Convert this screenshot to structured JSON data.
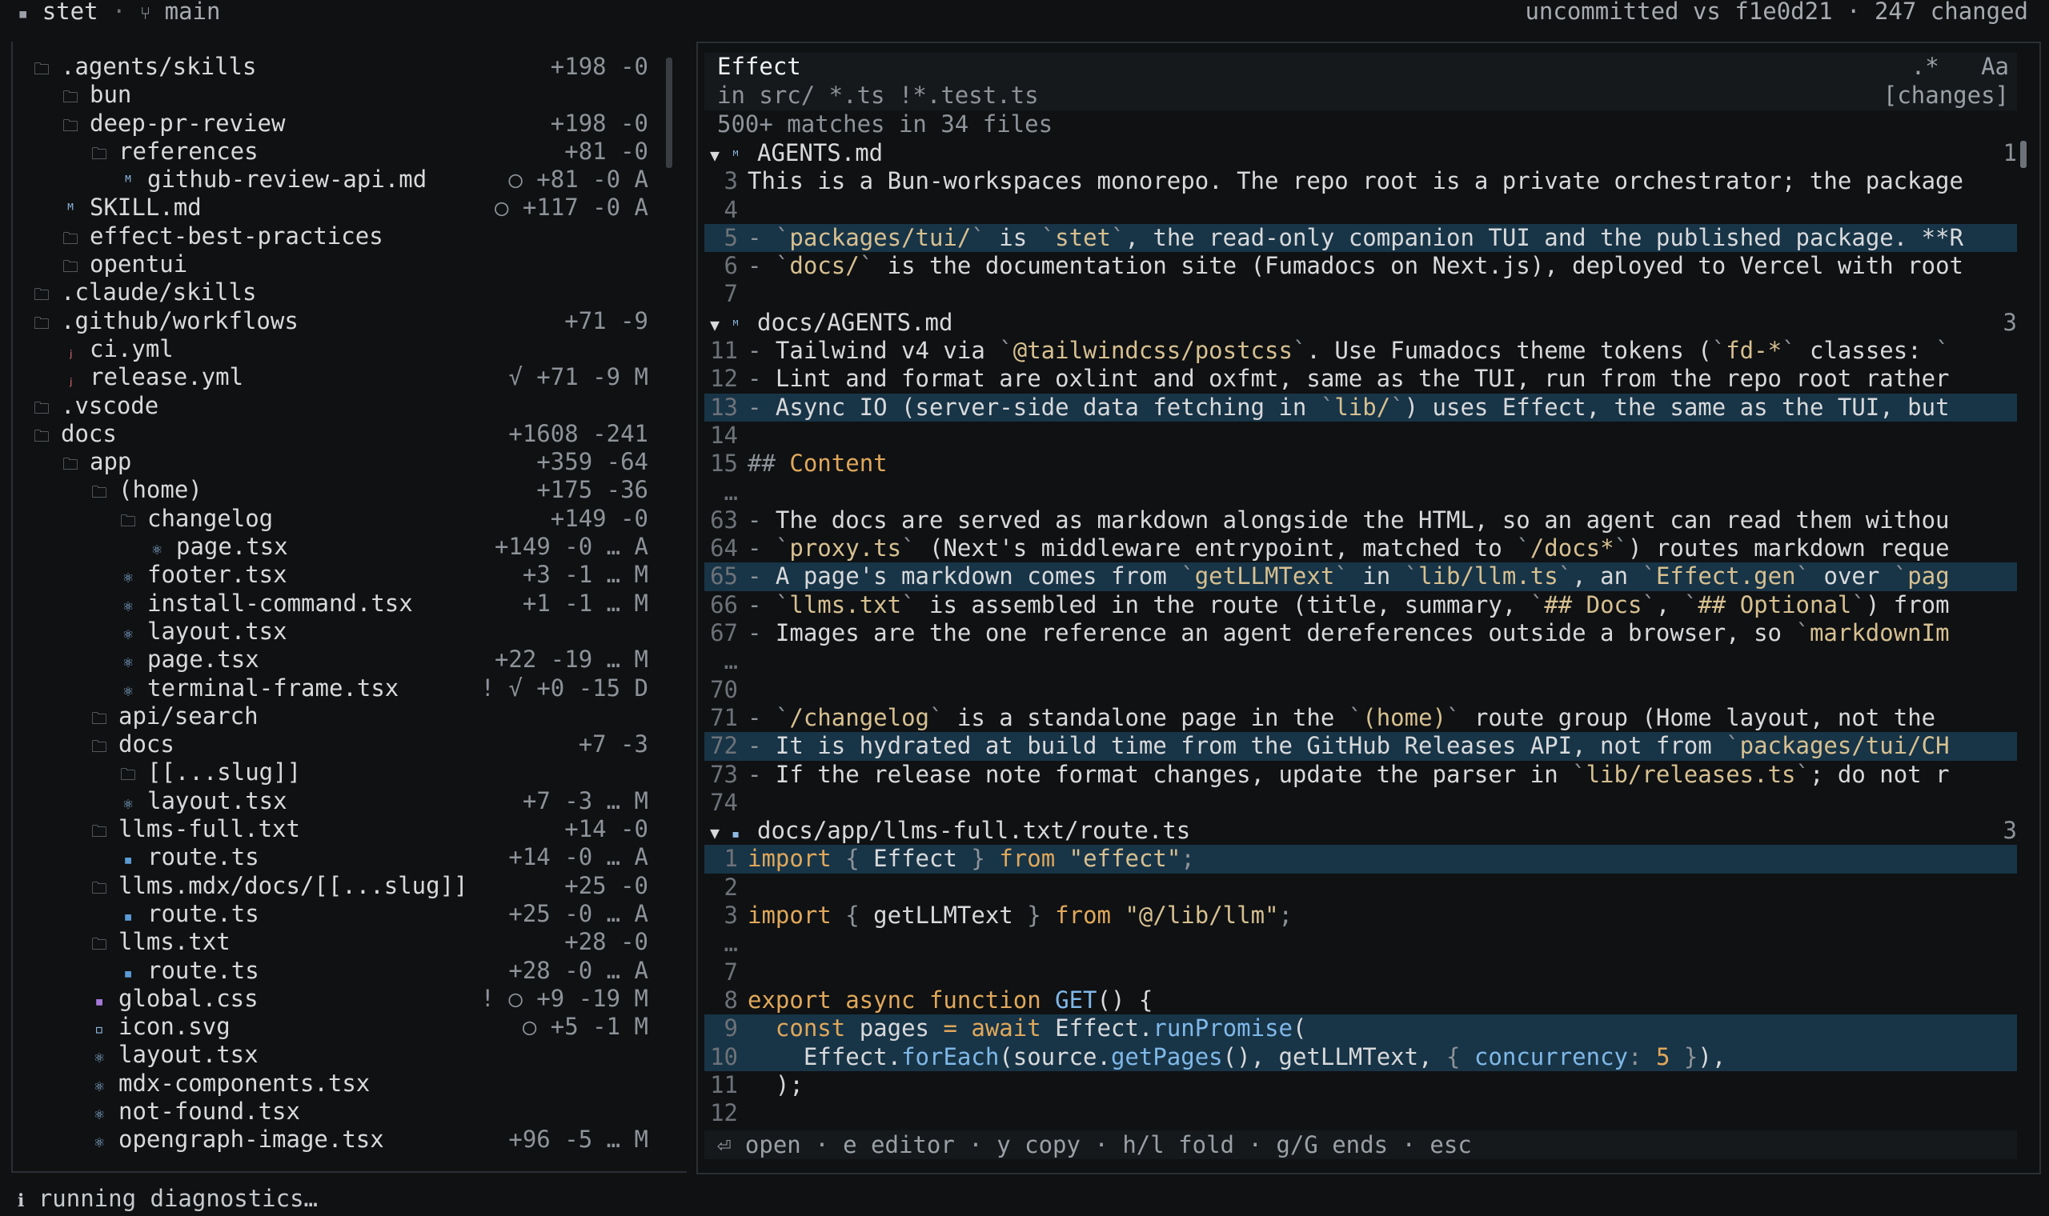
{
  "topbar": {
    "app": "stet",
    "sep": " · ",
    "branch_icon": "branch-icon",
    "branch": "main",
    "compare": "uncommitted vs f1e0d21 · 247 changed"
  },
  "tree": [
    {
      "depth": 0,
      "icon": "folder",
      "name": ".agents/skills",
      "stat": "+198 -0",
      "nameColor": "default",
      "statColor": "orange"
    },
    {
      "depth": 1,
      "icon": "folder",
      "name": "bun",
      "stat": "",
      "nameColor": "default",
      "statColor": "default"
    },
    {
      "depth": 1,
      "icon": "folder",
      "name": "deep-pr-review",
      "stat": "+198 -0",
      "nameColor": "default",
      "statColor": "orange"
    },
    {
      "depth": 2,
      "icon": "folder",
      "name": "references",
      "stat": "+81 -0",
      "nameColor": "default",
      "statColor": "orange"
    },
    {
      "depth": 3,
      "icon": "md",
      "name": "github-review-api.md",
      "stat": "○ +81 -0 A",
      "nameColor": "default",
      "statColor": "default"
    },
    {
      "depth": 1,
      "icon": "md",
      "name": "SKILL.md",
      "stat": "○ +117 -0 A",
      "nameColor": "cyan",
      "statColor": "default"
    },
    {
      "depth": 1,
      "icon": "folder",
      "name": "effect-best-practices",
      "stat": "",
      "nameColor": "default",
      "statColor": "default"
    },
    {
      "depth": 1,
      "icon": "folder",
      "name": "opentui",
      "stat": "",
      "nameColor": "default",
      "statColor": "default"
    },
    {
      "depth": 0,
      "icon": "folder",
      "name": ".claude/skills",
      "stat": "",
      "nameColor": "default",
      "statColor": "default"
    },
    {
      "depth": 0,
      "icon": "folder",
      "name": ".github/workflows",
      "stat": "+71 -9",
      "nameColor": "default",
      "statColor": "orange"
    },
    {
      "depth": 1,
      "icon": "yml",
      "name": "ci.yml",
      "stat": "",
      "nameColor": "default",
      "statColor": "default"
    },
    {
      "depth": 1,
      "icon": "yml",
      "name": "release.yml",
      "stat": "√ +71 -9 M",
      "nameColor": "orange",
      "statColor": "default"
    },
    {
      "depth": 0,
      "icon": "folder",
      "name": ".vscode",
      "stat": "",
      "nameColor": "default",
      "statColor": "default"
    },
    {
      "depth": 0,
      "icon": "folder",
      "name": "docs",
      "stat": "+1608 -241",
      "nameColor": "default",
      "statColor": "orange"
    },
    {
      "depth": 1,
      "icon": "folder",
      "name": "app",
      "stat": "+359 -64",
      "nameColor": "default",
      "statColor": "orange"
    },
    {
      "depth": 2,
      "icon": "folder",
      "name": "(home)",
      "stat": "+175 -36",
      "nameColor": "default",
      "statColor": "orange"
    },
    {
      "depth": 3,
      "icon": "folder",
      "name": "changelog",
      "stat": "+149 -0",
      "nameColor": "default",
      "statColor": "orange"
    },
    {
      "depth": 4,
      "icon": "react",
      "name": "page.tsx",
      "stat": "+149 -0 … A",
      "nameColor": "cyan",
      "statColor": "default"
    },
    {
      "depth": 3,
      "icon": "react",
      "name": "footer.tsx",
      "stat": "+3 -1 … M",
      "nameColor": "orange",
      "statColor": "default"
    },
    {
      "depth": 3,
      "icon": "react",
      "name": "install-command.tsx",
      "stat": "+1 -1 … M",
      "nameColor": "orange",
      "statColor": "default"
    },
    {
      "depth": 3,
      "icon": "react",
      "name": "layout.tsx",
      "stat": "",
      "nameColor": "default",
      "statColor": "default"
    },
    {
      "depth": 3,
      "icon": "react",
      "name": "page.tsx",
      "stat": "+22 -19 … M",
      "nameColor": "orange",
      "statColor": "default"
    },
    {
      "depth": 3,
      "icon": "react",
      "name": "terminal-frame.tsx",
      "stat": "! √ +0 -15 D",
      "nameColor": "red",
      "statColor": "default"
    },
    {
      "depth": 2,
      "icon": "folder",
      "name": "api/search",
      "stat": "",
      "nameColor": "default",
      "statColor": "default"
    },
    {
      "depth": 2,
      "icon": "folder",
      "name": "docs",
      "stat": "+7 -3",
      "nameColor": "default",
      "statColor": "orange"
    },
    {
      "depth": 3,
      "icon": "folder",
      "name": "[[...slug]]",
      "stat": "",
      "nameColor": "default",
      "statColor": "default"
    },
    {
      "depth": 3,
      "icon": "react",
      "name": "layout.tsx",
      "stat": "+7 -3 … M",
      "nameColor": "orange",
      "statColor": "default"
    },
    {
      "depth": 2,
      "icon": "folder",
      "name": "llms-full.txt",
      "stat": "+14 -0",
      "nameColor": "default",
      "statColor": "orange"
    },
    {
      "depth": 3,
      "icon": "ts",
      "name": "route.ts",
      "stat": "+14 -0 … A",
      "nameColor": "cyan",
      "statColor": "default"
    },
    {
      "depth": 2,
      "icon": "folder",
      "name": "llms.mdx/docs/[[...slug]]",
      "stat": "+25 -0",
      "nameColor": "default",
      "statColor": "orange"
    },
    {
      "depth": 3,
      "icon": "ts",
      "name": "route.ts",
      "stat": "+25 -0 … A",
      "nameColor": "cyan",
      "statColor": "default"
    },
    {
      "depth": 2,
      "icon": "folder",
      "name": "llms.txt",
      "stat": "+28 -0",
      "nameColor": "default",
      "statColor": "orange"
    },
    {
      "depth": 3,
      "icon": "ts",
      "name": "route.ts",
      "stat": "+28 -0 … A",
      "nameColor": "cyan",
      "statColor": "default"
    },
    {
      "depth": 2,
      "icon": "css",
      "name": "global.css",
      "stat": "! ○ +9 -19 M",
      "nameColor": "orange",
      "statColor": "default"
    },
    {
      "depth": 2,
      "icon": "svg",
      "name": "icon.svg",
      "stat": "○ +5 -1 M",
      "nameColor": "orange",
      "statColor": "default"
    },
    {
      "depth": 2,
      "icon": "react",
      "name": "layout.tsx",
      "stat": "",
      "nameColor": "default",
      "statColor": "default"
    },
    {
      "depth": 2,
      "icon": "react",
      "name": "mdx-components.tsx",
      "stat": "",
      "nameColor": "default",
      "statColor": "default"
    },
    {
      "depth": 2,
      "icon": "react",
      "name": "not-found.tsx",
      "stat": "",
      "nameColor": "default",
      "statColor": "default"
    },
    {
      "depth": 2,
      "icon": "react",
      "name": "opengraph-image.tsx",
      "stat": "+96 -5 … M",
      "nameColor": "orange",
      "statColor": "default"
    }
  ],
  "search": {
    "query": "Effect",
    "regex_toggle": ".*",
    "case_toggle": "Aa",
    "scope": "in src/ *.ts !*.test.ts",
    "changes_filter": "[changes]",
    "summary": "500+ matches in 34 files"
  },
  "results": [
    {
      "kind": "file",
      "name": "AGENTS.md",
      "count": "1",
      "icon": "md"
    },
    {
      "kind": "line",
      "ln": "3",
      "text": "This is a Bun-workspaces monorepo. The repo root is a private orchestrator; the package",
      "sel": false
    },
    {
      "kind": "line",
      "ln": "4",
      "text": "",
      "sel": false
    },
    {
      "kind": "line",
      "ln": "5",
      "text": "- `packages/tui/` is `stet`, the read-only companion TUI and the published package. **R",
      "sel": true
    },
    {
      "kind": "line",
      "ln": "6",
      "text": "- `docs/` is the documentation site (Fumadocs on Next.js), deployed to Vercel with root",
      "sel": false
    },
    {
      "kind": "line",
      "ln": "7",
      "text": "",
      "sel": false
    },
    {
      "kind": "file",
      "name": "docs/AGENTS.md",
      "count": "3",
      "icon": "md"
    },
    {
      "kind": "line",
      "ln": "11",
      "text": "- Tailwind v4 via `@tailwindcss/postcss`. Use Fumadocs theme tokens (`fd-*` classes: `",
      "sel": false
    },
    {
      "kind": "line",
      "ln": "12",
      "text": "- Lint and format are oxlint and oxfmt, same as the TUI, run from the repo root rather",
      "sel": false
    },
    {
      "kind": "line",
      "ln": "13",
      "text": "- Async IO (server-side data fetching in `lib/`) uses Effect, the same as the TUI, but",
      "sel": true
    },
    {
      "kind": "line",
      "ln": "14",
      "text": "",
      "sel": false
    },
    {
      "kind": "line",
      "ln": "15",
      "text": "## Content",
      "sel": false
    },
    {
      "kind": "gap",
      "ln": "…",
      "text": "",
      "sel": false
    },
    {
      "kind": "line",
      "ln": "63",
      "text": "- The docs are served as markdown alongside the HTML, so an agent can read them withou",
      "sel": false
    },
    {
      "kind": "line",
      "ln": "64",
      "text": "- `proxy.ts` (Next's middleware entrypoint, matched to `/docs*`) routes markdown reque",
      "sel": false
    },
    {
      "kind": "line",
      "ln": "65",
      "text": "- A page's markdown comes from `getLLMText` in `lib/llm.ts`, an `Effect.gen` over `pag",
      "sel": true
    },
    {
      "kind": "line",
      "ln": "66",
      "text": "- `llms.txt` is assembled in the route (title, summary, `## Docs`, `## Optional`) from",
      "sel": false
    },
    {
      "kind": "line",
      "ln": "67",
      "text": "- Images are the one reference an agent dereferences outside a browser, so `markdownIm",
      "sel": false
    },
    {
      "kind": "gap",
      "ln": "…",
      "text": "",
      "sel": false
    },
    {
      "kind": "line",
      "ln": "70",
      "text": "",
      "sel": false
    },
    {
      "kind": "line",
      "ln": "71",
      "text": "- `/changelog` is a standalone page in the `(home)` route group (Home layout, not the",
      "sel": false
    },
    {
      "kind": "line",
      "ln": "72",
      "text": "- It is hydrated at build time from the GitHub Releases API, not from `packages/tui/CH",
      "sel": true
    },
    {
      "kind": "line",
      "ln": "73",
      "text": "- If the release note format changes, update the parser in `lib/releases.ts`; do not r",
      "sel": false
    },
    {
      "kind": "line",
      "ln": "74",
      "text": "",
      "sel": false
    },
    {
      "kind": "file",
      "name": "docs/app/llms-full.txt/route.ts",
      "count": "3",
      "icon": "ts"
    },
    {
      "kind": "code",
      "ln": "1",
      "html": "import",
      "sel": true
    },
    {
      "kind": "line",
      "ln": "2",
      "text": "",
      "sel": false
    },
    {
      "kind": "code",
      "ln": "3",
      "html": "import2",
      "sel": false
    },
    {
      "kind": "gap",
      "ln": "…",
      "text": "",
      "sel": false
    },
    {
      "kind": "line",
      "ln": "7",
      "text": "",
      "sel": false
    },
    {
      "kind": "code",
      "ln": "8",
      "html": "export",
      "sel": false
    },
    {
      "kind": "code",
      "ln": "9",
      "html": "const",
      "sel": true
    },
    {
      "kind": "code",
      "ln": "10",
      "html": "foreach",
      "sel": true
    },
    {
      "kind": "line",
      "ln": "11",
      "text": "  );",
      "sel": false
    },
    {
      "kind": "line",
      "ln": "12",
      "text": "",
      "sel": false
    }
  ],
  "hints": "⏎ open · e editor · y copy · h/l fold · g/G ends · esc",
  "status": {
    "icon": "info-icon",
    "text": "running diagnostics…"
  }
}
